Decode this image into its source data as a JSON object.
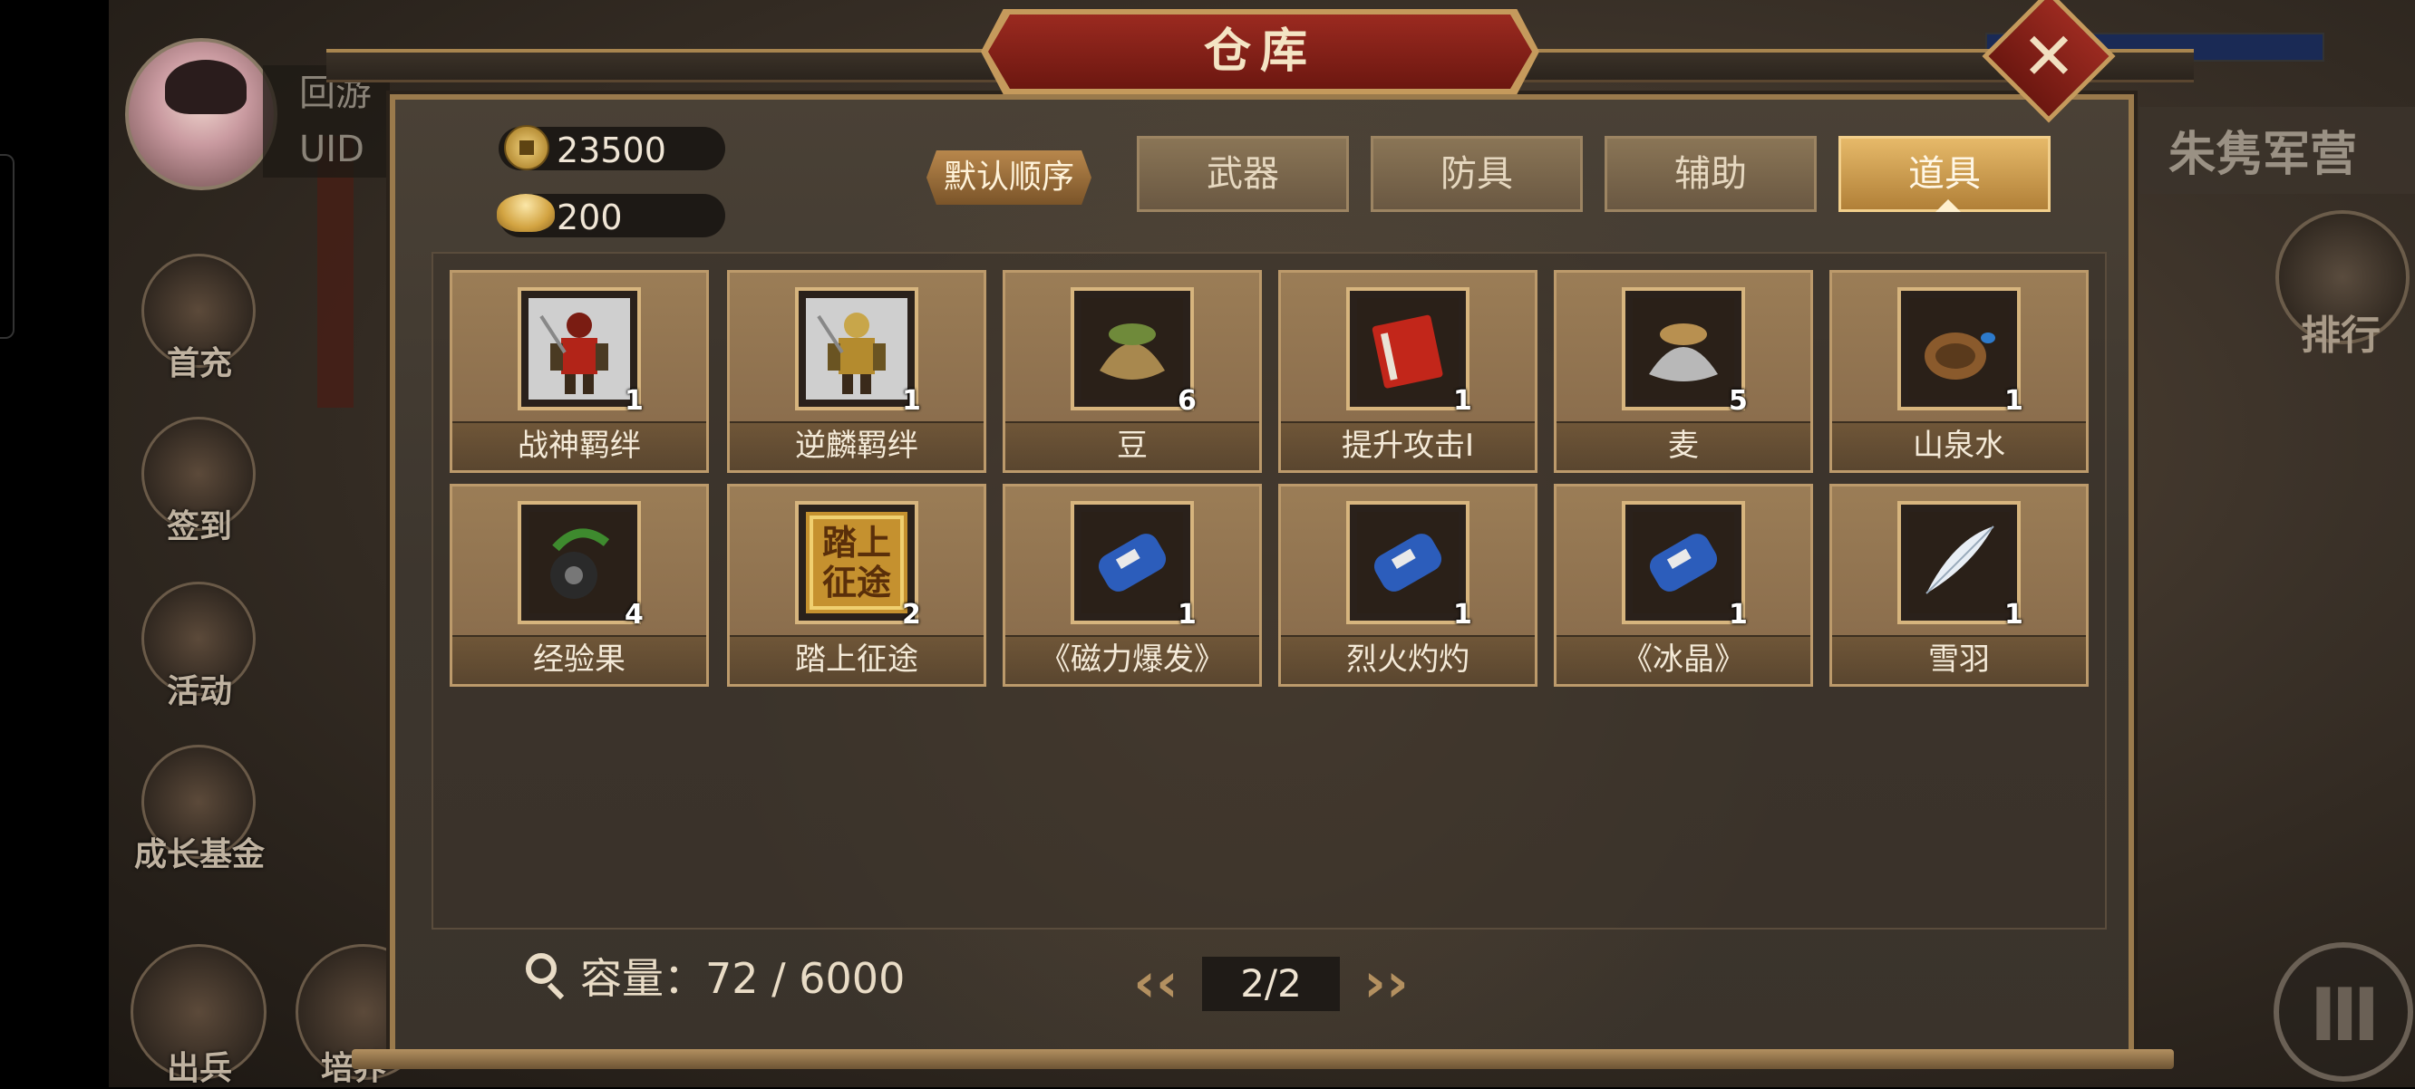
{
  "title": "仓库",
  "user": {
    "name": "回游",
    "uid_label": "UID"
  },
  "side_menu": [
    "首充",
    "签到",
    "活动",
    "成长基金",
    "出兵",
    "培养"
  ],
  "right": {
    "camp": "朱隽军营",
    "rank": "排行"
  },
  "currency": {
    "coins": "23500",
    "ingots": "200"
  },
  "sort_label": "默认顺序",
  "tabs": [
    {
      "label": "武器",
      "active": false
    },
    {
      "label": "防具",
      "active": false
    },
    {
      "label": "辅助",
      "active": false
    },
    {
      "label": "道具",
      "active": true
    }
  ],
  "items": [
    {
      "name": "战神羁绊",
      "count": "1",
      "icon": "warrior-red-icon"
    },
    {
      "name": "逆麟羁绊",
      "count": "1",
      "icon": "warrior-gold-icon"
    },
    {
      "name": "豆",
      "count": "6",
      "icon": "bean-sack-icon"
    },
    {
      "name": "提升攻击Ⅰ",
      "count": "1",
      "icon": "red-book-icon"
    },
    {
      "name": "麦",
      "count": "5",
      "icon": "wheat-sack-icon"
    },
    {
      "name": "山泉水",
      "count": "1",
      "icon": "water-gourd-icon"
    },
    {
      "name": "经验果",
      "count": "4",
      "icon": "exp-fruit-icon"
    },
    {
      "name": "踏上征途",
      "count": "2",
      "icon": "journey-seal-icon"
    },
    {
      "name": "《磁力爆发》",
      "count": "1",
      "icon": "blue-scroll-icon"
    },
    {
      "name": "烈火灼灼",
      "count": "1",
      "icon": "blue-scroll-icon"
    },
    {
      "name": "《冰晶》",
      "count": "1",
      "icon": "blue-scroll-icon"
    },
    {
      "name": "雪羽",
      "count": "1",
      "icon": "white-feather-icon"
    }
  ],
  "journey_seal_text": "踏上征途",
  "capacity": "容量：72 / 6000",
  "pagination": {
    "page": "2/2"
  }
}
